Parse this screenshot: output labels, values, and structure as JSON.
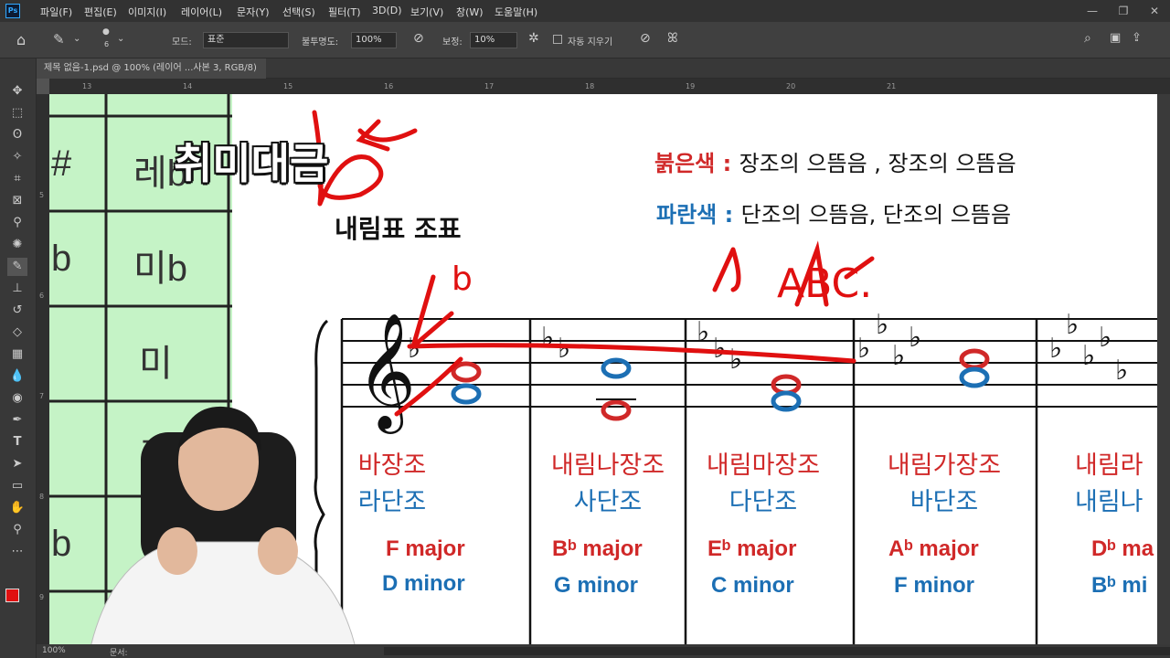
{
  "app": {
    "logo": "Ps"
  },
  "menu": [
    "파일(F)",
    "편집(E)",
    "이미지(I)",
    "레이어(L)",
    "문자(Y)",
    "선택(S)",
    "필터(T)",
    "3D(D)",
    "보기(V)",
    "창(W)",
    "도움말(H)"
  ],
  "window_controls": [
    "—",
    "❐",
    "✕"
  ],
  "options": {
    "brush_size": "6",
    "mode_label": "모드:",
    "mode_value": "표준",
    "opacity_label": "불투명도:",
    "opacity_value": "100%",
    "smoothing_label": "보정:",
    "smoothing_value": "10%",
    "auto_erase_label": "자동 지우기"
  },
  "document": {
    "tab_label": "제목 없음-1.psd @ 100% (레이어 ...사본 3, RGB/8)",
    "zoom": "100%",
    "status_text": "문서:"
  },
  "rulers": {
    "h_ticks": [
      "13",
      "14",
      "15",
      "16",
      "17",
      "18",
      "19",
      "20",
      "21"
    ],
    "v_ticks": [
      "5",
      "6",
      "7",
      "8",
      "9"
    ]
  },
  "watermark": "취미대금",
  "green_table": {
    "col_labels": [
      "#",
      "b",
      "",
      "",
      "",
      "b"
    ],
    "values": [
      "레b",
      "미b",
      "미",
      "파",
      "",
      ""
    ]
  },
  "slide": {
    "title": "내림표 조표",
    "legend": [
      {
        "label": "붉은색 :",
        "text": "장조의 으뜸음 , 장조의 으뜸음",
        "color": "#d02828"
      },
      {
        "label": "파란색 :",
        "text": "단조의 으뜸음, 단조의 으뜸음",
        "color": "#1c6fb4"
      }
    ],
    "keys": [
      {
        "major_kr": "바장조",
        "minor_kr": "라단조",
        "major_en": "F major",
        "minor_en": "D minor",
        "flats": 1
      },
      {
        "major_kr": "내림나장조",
        "minor_kr": "사단조",
        "major_en": "Bᵇ major",
        "minor_en": "G minor",
        "flats": 2
      },
      {
        "major_kr": "내림마장조",
        "minor_kr": "다단조",
        "major_en": "Eᵇ major",
        "minor_en": "C minor",
        "flats": 3
      },
      {
        "major_kr": "내림가장조",
        "minor_kr": "바단조",
        "major_en": "Aᵇ major",
        "minor_en": "F minor",
        "flats": 4
      },
      {
        "major_kr": "내림라",
        "minor_kr": "내림나",
        "major_en": "Dᵇ ma",
        "minor_en": "Bᵇ mi",
        "flats": 5
      }
    ],
    "annotations": [
      "b",
      "ABC."
    ]
  },
  "colors": {
    "foreground": "#e01010",
    "background": "#ffffff",
    "accent": "#31a8ff"
  }
}
